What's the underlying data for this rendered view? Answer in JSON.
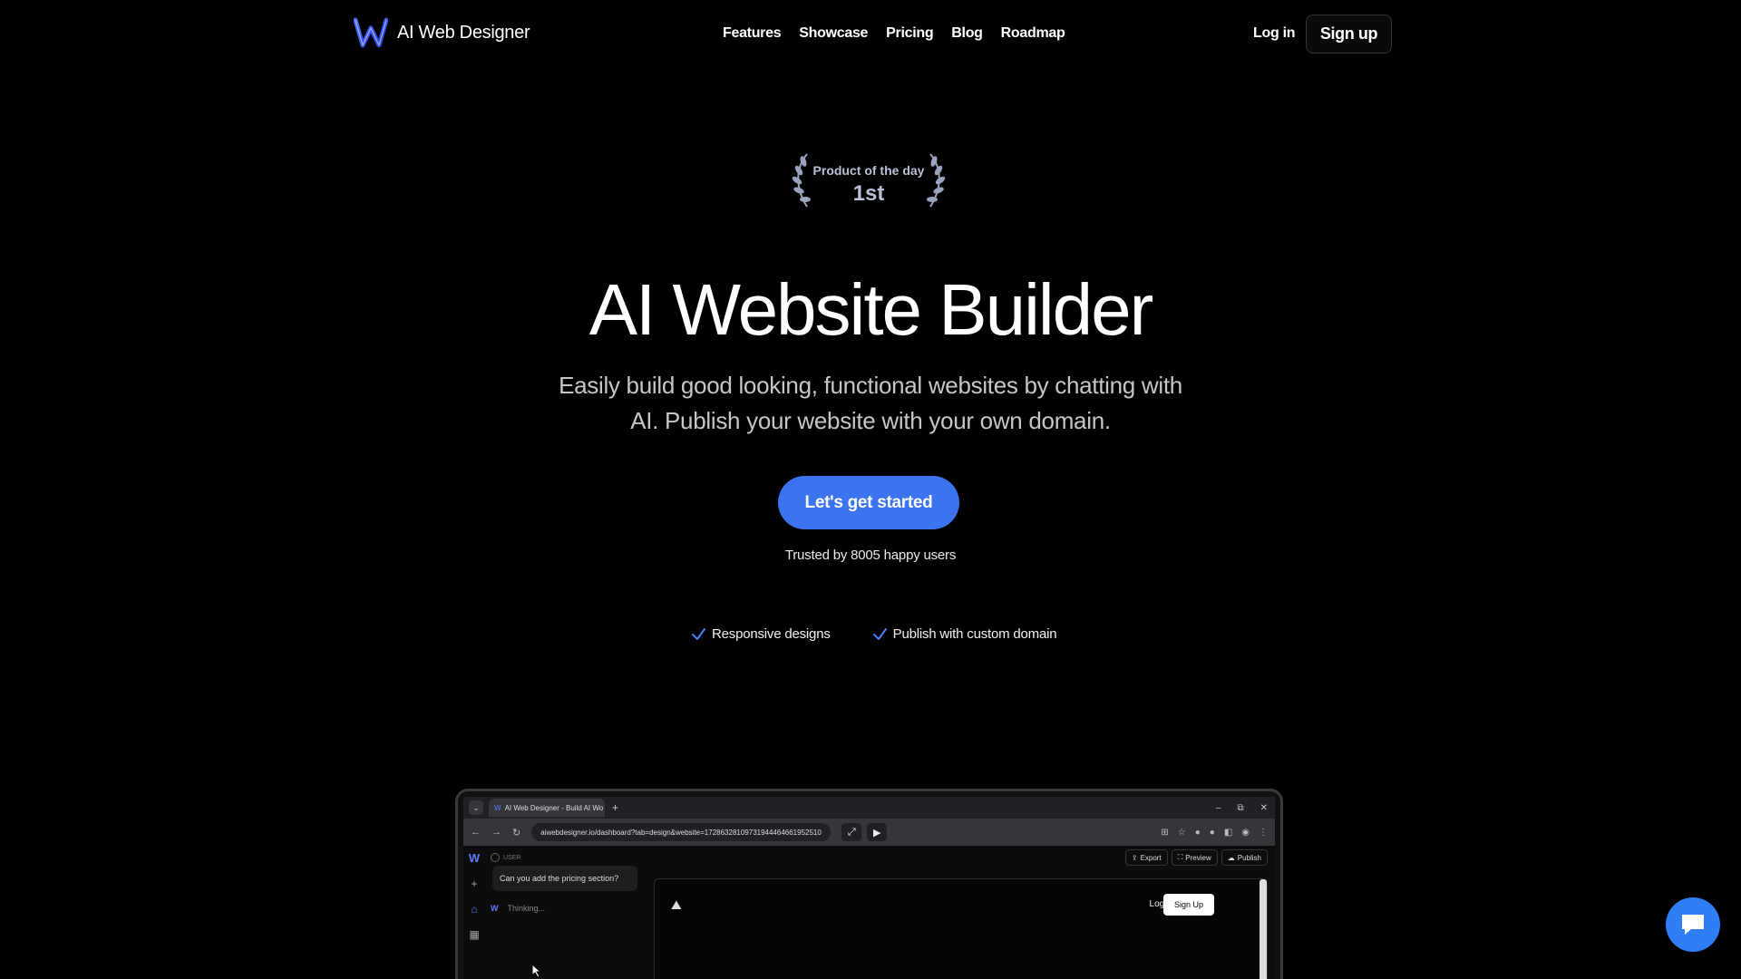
{
  "nav": {
    "brand": "AI Web Designer",
    "links": [
      "Features",
      "Showcase",
      "Pricing",
      "Blog",
      "Roadmap"
    ],
    "login": "Log in",
    "signup": "Sign up"
  },
  "badge": {
    "label": "Product of the day",
    "rank": "1st"
  },
  "hero": {
    "title": "AI Website Builder",
    "subtitle": "Easily build good looking, functional websites by chatting with AI. Publish your website with your own domain.",
    "cta": "Let's get started",
    "trusted": "Trusted by 8005 happy users"
  },
  "features": [
    "Responsive designs",
    "Publish with custom domain"
  ],
  "preview": {
    "tab_title": "AI Web Designer - Build AI Wo",
    "url": "aiwebdesigner.io/dashboard?tab=design&website=17286328109731944464661952510",
    "user_label": "USER",
    "user_message": "Can you add the pricing section?",
    "thinking": "Thinking...",
    "actions": [
      "Export",
      "Preview",
      "Publish"
    ],
    "site_login": "Login",
    "site_signup": "Sign Up"
  },
  "colors": {
    "background": "#000000",
    "accent": "#3b74ee",
    "chat_button": "#2e7ff5"
  }
}
